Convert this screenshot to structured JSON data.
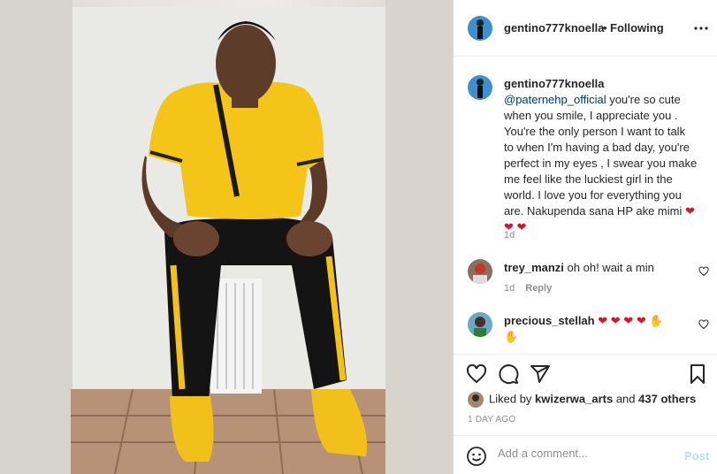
{
  "post": {
    "username": "gentino777knoella",
    "dot": "•",
    "follow_status": "Following"
  },
  "caption": {
    "username": "gentino777knoella",
    "mention": "@paternehp_official",
    "text_line1": " you're so cute",
    "text_line2": "when you smile, I appreciate you .",
    "text_line3": "You're the only person I want to talk",
    "text_line4": "to when I'm having a bad day, you're",
    "text_line5": "perfect in my eyes , I swear you make",
    "text_line6": "me feel like the luckiest girl in the",
    "text_line7": "world. I love you for everything you",
    "text_line8": "are. Nakupenda sana HP ake mimi",
    "time": "1d"
  },
  "comments": [
    {
      "username": "trey_manzi",
      "text": "oh oh! wait a min",
      "time": "1d",
      "reply_label": "Reply"
    },
    {
      "username": "precious_stellah",
      "text": ""
    }
  ],
  "likes": {
    "prefix": "Liked by ",
    "user": "kwizerwa_arts",
    "middle": " and ",
    "count": "437 others"
  },
  "post_date": "1 DAY AGO",
  "add_comment": {
    "placeholder": "Add a comment...",
    "post_label": "Post"
  },
  "colors": {
    "heart": "#e0102c",
    "mention": "#00376b",
    "post_button_disabled": "#b2dffc",
    "meta_gray": "#8e8e8e"
  },
  "icons": [
    "more-icon",
    "heart-icon",
    "comment-icon",
    "share-icon",
    "bookmark-icon",
    "emoji-icon"
  ]
}
